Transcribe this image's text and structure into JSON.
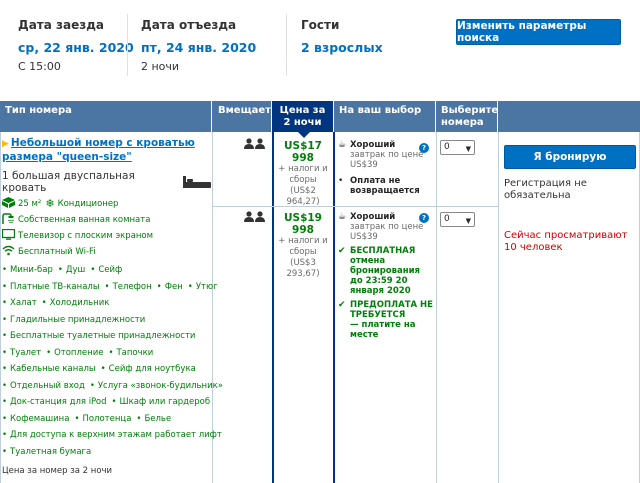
{
  "summary": {
    "checkin_label": "Дата заезда",
    "checkin_value": "ср, 22 янв. 2020",
    "checkin_sub": "С 15:00",
    "checkout_label": "Дата отъезда",
    "checkout_value": "пт, 24 янв. 2020",
    "checkout_sub": "2 ночи",
    "guests_label": "Гости",
    "guests_value": "2 взрослых",
    "change_button": "Изменить параметры поиска"
  },
  "table": {
    "headers": {
      "room_type": "Тип номера",
      "sleeps": "Вмещает",
      "price": "Цена за 2 ночи",
      "choice": "На ваш выбор",
      "select_rooms": "Выберите номера"
    }
  },
  "room": {
    "name": "Небольшой номер с кроватью размера \"queen-size\"",
    "bed": "1 большая двуспальная кровать",
    "area": "25 м²",
    "ac": "Кондиционер",
    "bathroom": "Собственная ванная комната",
    "tv": "Телевизор с плоским экраном",
    "wifi": "Бесплатный Wi-Fi",
    "amenity_lines": [
      [
        "Мини-бар",
        "Душ",
        "Сейф"
      ],
      [
        "Платные ТВ-каналы",
        "Телефон",
        "Фен",
        "Утюг"
      ],
      [
        "Халат",
        "Холодильник"
      ],
      [
        "Гладильные принадлежности"
      ],
      [
        "Бесплатные туалетные принадлежности"
      ],
      [
        "Туалет",
        "Отопление",
        "Тапочки"
      ],
      [
        "Кабельные каналы",
        "Сейф для ноутбука"
      ],
      [
        "Отдельный вход",
        "Услуга «звонок-будильник»"
      ],
      [
        "Док-станция для iPod",
        "Шкаф или гардероб"
      ],
      [
        "Кофемашина",
        "Полотенца",
        "Белье"
      ],
      [
        "Для доступа к верхним этажам работает лифт"
      ],
      [
        "Туалетная бумага"
      ]
    ],
    "price_note": "Цена за номер за 2 ночи"
  },
  "options": [
    {
      "price": "US$17 998",
      "taxes": "+ налоги и сборы",
      "taxes_amount": "(US$2 964,27)",
      "breakfast_bold": "Хороший",
      "breakfast_rest": "завтрак по цене US$39",
      "policy": "Оплата не возвращается",
      "select_value": "0"
    },
    {
      "price": "US$19 998",
      "taxes": "+ налоги и сборы",
      "taxes_amount": "(US$3 293,67)",
      "breakfast_bold": "Хороший",
      "breakfast_rest": "завтрак по цене US$39",
      "free_cancel": "БЕСПЛАТНАЯ",
      "free_cancel_rest": "отмена бронирования до 23:59 20 января 2020",
      "no_prepay": "ПРЕДОПЛАТА НЕ ТРЕБУЕТСЯ",
      "no_prepay_rest": "— платите на месте",
      "select_value": "0"
    }
  ],
  "booking": {
    "button": "Я бронирую",
    "note": "Регистрация не обязательна",
    "viewers": "Сейчас просматривают 10 человек"
  },
  "colors": {
    "header_bg": "#4b76a4",
    "price_header_bg": "#003580",
    "accent_blue": "#0071c2",
    "green": "#008009",
    "red": "#cc0000"
  }
}
